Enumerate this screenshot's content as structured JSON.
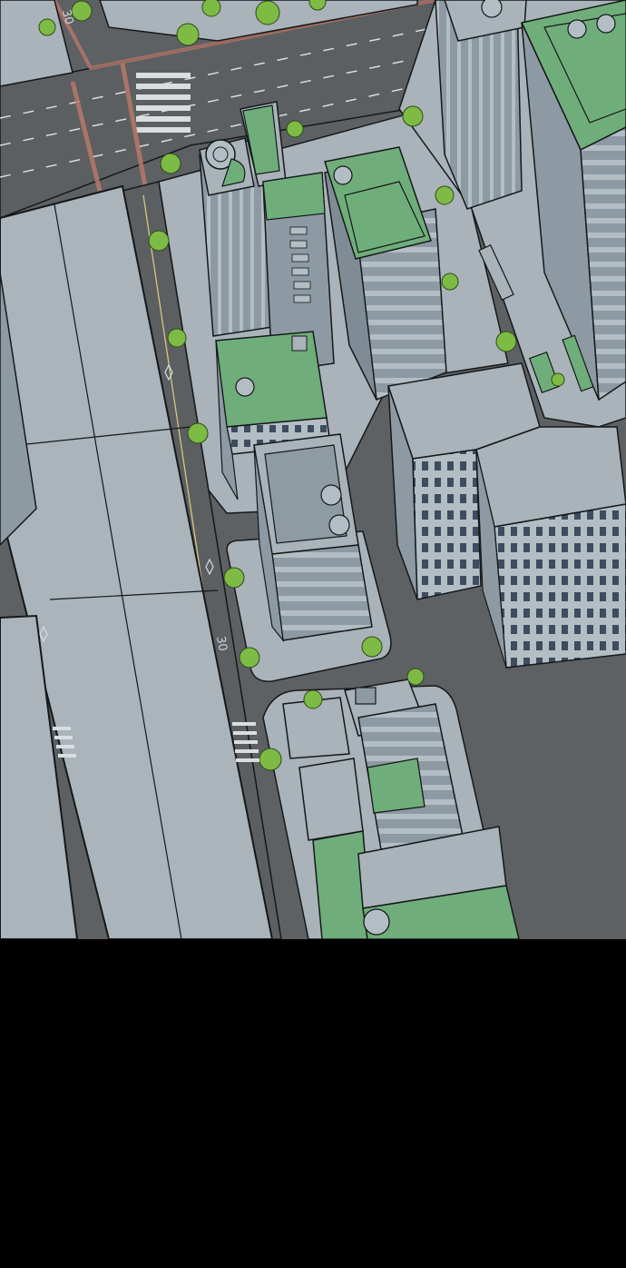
{
  "scene": {
    "description_kind": "aerial city illustration",
    "road_markings": [
      "30",
      "30"
    ],
    "colors": {
      "asphalt": "#5e6163",
      "sidewalk": "#a9b3b9",
      "building_light": "#b3bec4",
      "building_mid": "#8d9aa3",
      "window": "#3f4b5e",
      "roof_green": "#6fae7a",
      "tree": "#7dbb45",
      "outline": "#15181a",
      "crosswalk_red": "#b97869",
      "bottom_band": "#000000"
    }
  }
}
